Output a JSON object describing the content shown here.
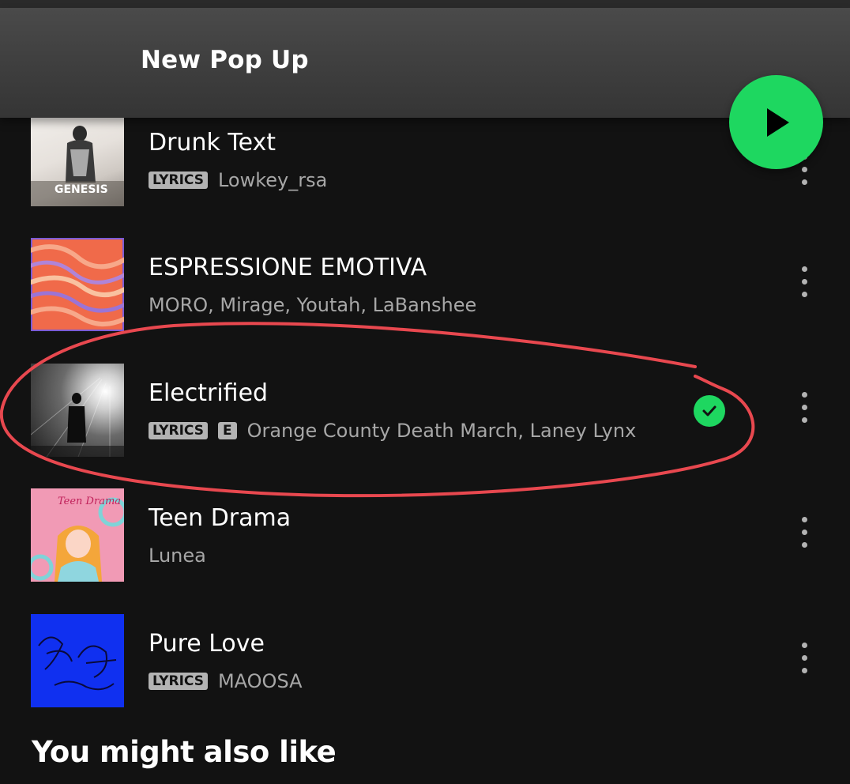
{
  "header": {
    "title": "New Pop Up"
  },
  "play_button": {
    "icon": "play-icon",
    "color": "#1ed760"
  },
  "badges": {
    "lyrics": "LYRICS",
    "explicit": "E"
  },
  "tracks": [
    {
      "title": "Drunk Text",
      "artists": "Lowkey_rsa",
      "lyrics": true,
      "explicit": false,
      "downloaded": false,
      "cover_text": "GENESIS"
    },
    {
      "title": "ESPRESSIONE EMOTIVA",
      "artists": "MORO, Mirage, Youtah, LaBanshee",
      "lyrics": false,
      "explicit": false,
      "downloaded": false
    },
    {
      "title": "Electrified",
      "artists": "Orange County Death March, Laney Lynx",
      "lyrics": true,
      "explicit": true,
      "downloaded": true,
      "highlighted": true
    },
    {
      "title": "Teen Drama",
      "artists": "Lunea",
      "lyrics": false,
      "explicit": false,
      "downloaded": false,
      "cover_text": "Teen Drama"
    },
    {
      "title": "Pure Love",
      "artists": "MAOOSA",
      "lyrics": true,
      "explicit": false,
      "downloaded": false
    }
  ],
  "section": {
    "title": "You might also like"
  },
  "colors": {
    "background": "#121212",
    "accent": "#1ed760",
    "annotation": "#e8484f",
    "secondary_text": "#a7a7a7"
  }
}
